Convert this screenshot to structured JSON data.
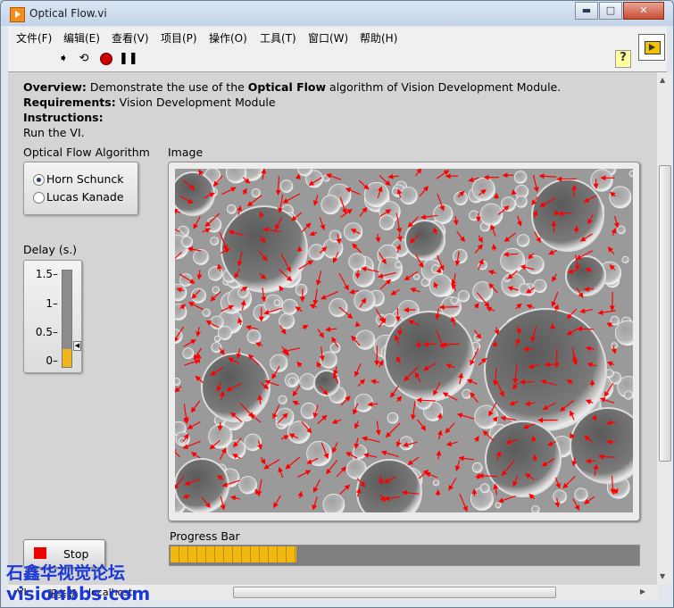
{
  "window": {
    "title": "Optical Flow.vi",
    "min": "▬",
    "max": "□",
    "close": "✕"
  },
  "menu": [
    "文件(F)",
    "编辑(E)",
    "查看(V)",
    "项目(P)",
    "操作(O)",
    "工具(T)",
    "窗口(W)",
    "帮助(H)"
  ],
  "toolbar": {
    "run_icon": "run-arrow-icon",
    "continuous_icon": "run-continuously-icon",
    "abort_icon": "abort-icon",
    "pause_icon": "pause-icon",
    "help": "?"
  },
  "info": {
    "overview_label": "Overview:",
    "overview_text1": " Demonstrate the use of the ",
    "overview_bold": "Optical Flow",
    "overview_text2": " algorithm of Vision Development Module.",
    "requirements_label": "Requirements:",
    "requirements_text": " Vision Development Module",
    "instructions_label": "Instructions:",
    "instructions_text": "Run the VI."
  },
  "algorithm": {
    "label": "Optical Flow Algorithm",
    "options": [
      "Horn Schunck",
      "Lucas Kanade"
    ],
    "selected": "Horn Schunck"
  },
  "delay": {
    "label": "Delay (s.)",
    "ticks": [
      "1.5",
      "1",
      "0.5",
      "0"
    ],
    "value": 0.02,
    "max": 1.5
  },
  "image": {
    "label": "Image"
  },
  "progress": {
    "label": "Progress Bar",
    "value": 0.27
  },
  "stop": {
    "label": "Stop"
  },
  "status": {
    "vi_label": "VI",
    "server_label": "服务器",
    "host": "localhost"
  },
  "watermark": {
    "cn": "石鑫华视觉论坛",
    "url": "visionbbs.com"
  },
  "colors": {
    "accent": "#f3b51c",
    "flow_arrow": "#ff0000",
    "stop_led": "#ee0000",
    "watermark": "#1a37d8"
  }
}
